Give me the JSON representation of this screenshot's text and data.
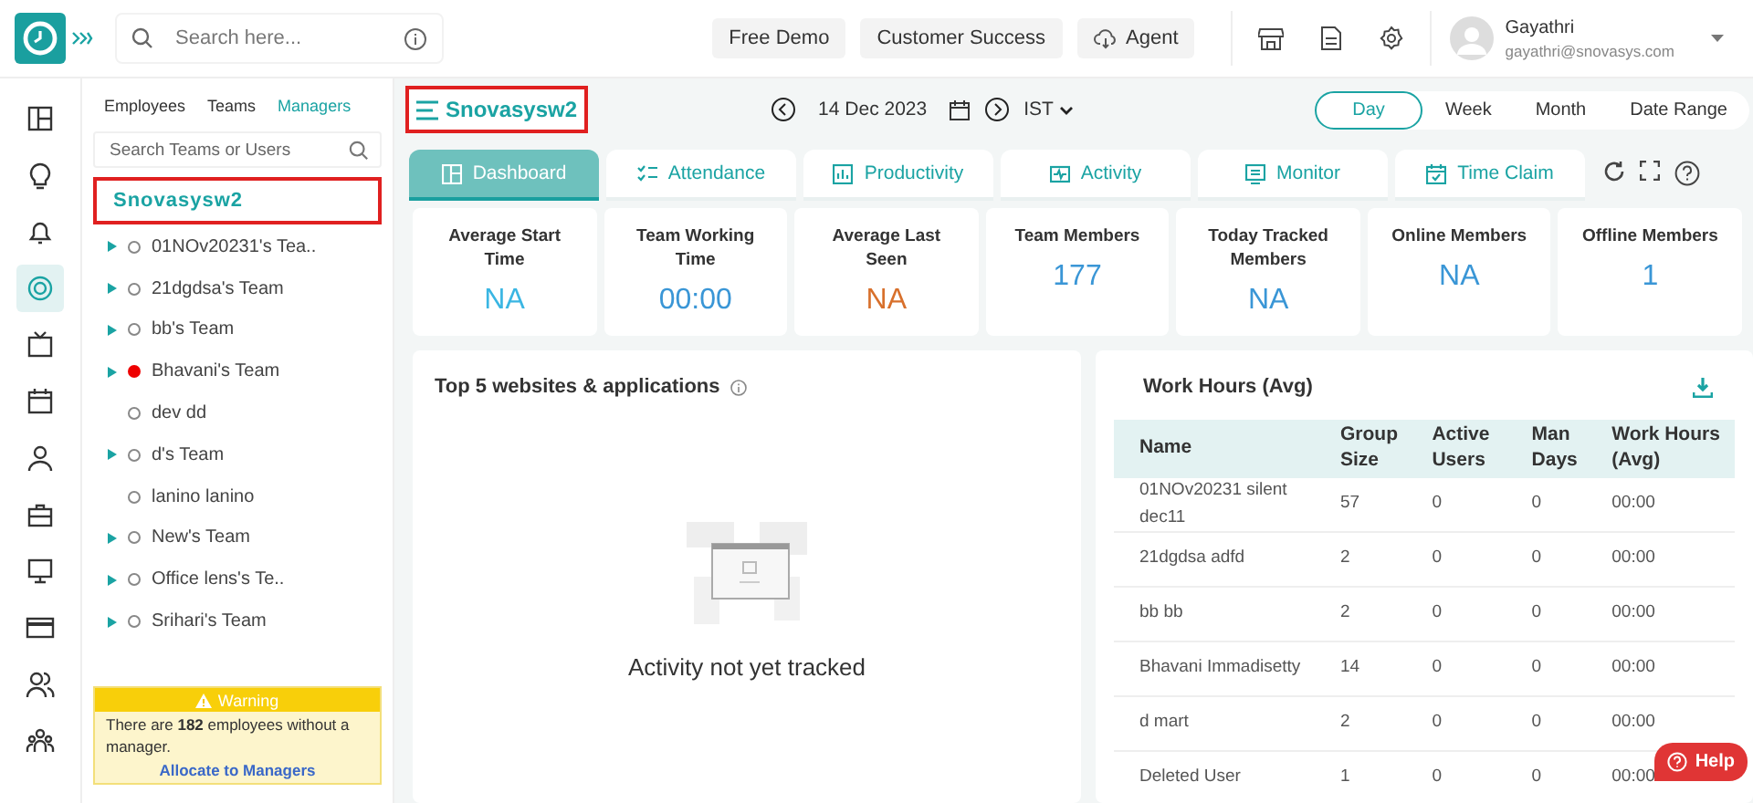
{
  "topbar": {
    "search": {
      "placeholder": "Search here..."
    },
    "buttons": [
      {
        "label": "Free Demo",
        "kind": "plain"
      },
      {
        "label": "Customer Success",
        "kind": "plain"
      },
      {
        "label": "Agent",
        "kind": "cloud"
      }
    ],
    "user": {
      "name": "Gayathri",
      "email": "gayathri@snovasys.com"
    }
  },
  "rail": [
    {
      "kind": "layout",
      "selected": false
    },
    {
      "kind": "bulb",
      "selected": false
    },
    {
      "kind": "bell",
      "selected": false
    },
    {
      "kind": "target",
      "selected": true
    },
    {
      "kind": "tv",
      "selected": false
    },
    {
      "kind": "calendar",
      "selected": false
    },
    {
      "kind": "user",
      "selected": false
    },
    {
      "kind": "briefcase",
      "selected": false
    },
    {
      "kind": "monitor",
      "selected": false
    },
    {
      "kind": "card",
      "selected": false
    },
    {
      "kind": "users",
      "selected": false
    },
    {
      "kind": "team",
      "selected": false
    }
  ],
  "panel": {
    "tabs": [
      {
        "label": "Employees",
        "selected": false
      },
      {
        "label": "Teams",
        "selected": false
      },
      {
        "label": "Managers",
        "selected": true
      }
    ],
    "search": {
      "placeholder": "Search Teams or Users"
    },
    "root": "Snovasysw2",
    "items": [
      {
        "label": "01NOv20231's Tea..",
        "expandable": true,
        "alert": false
      },
      {
        "label": "21dgdsa's Team",
        "expandable": true,
        "alert": false
      },
      {
        "label": "bb's Team",
        "expandable": true,
        "alert": false
      },
      {
        "label": "Bhavani's Team",
        "expandable": true,
        "alert": true
      },
      {
        "label": "dev dd",
        "expandable": false,
        "alert": false
      },
      {
        "label": "d's Team",
        "expandable": true,
        "alert": false
      },
      {
        "label": "lanino lanino",
        "expandable": false,
        "alert": false
      },
      {
        "label": "New's Team",
        "expandable": true,
        "alert": false
      },
      {
        "label": "Office lens's Te..",
        "expandable": true,
        "alert": false
      },
      {
        "label": "Srihari's Team",
        "expandable": true,
        "alert": false
      }
    ],
    "warning": {
      "title": "Warning",
      "text": "There are **182** employees without a manager.",
      "link": "Allocate to Managers"
    }
  },
  "header": {
    "title": "Snovasysw2",
    "date": "14 Dec 2023",
    "timezone": "IST",
    "periods": [
      {
        "label": "Day",
        "selected": true
      },
      {
        "label": "Week",
        "selected": false
      },
      {
        "label": "Month",
        "selected": false
      },
      {
        "label": "Date Range",
        "selected": false
      }
    ]
  },
  "tabs": [
    {
      "label": "Dashboard",
      "kind": "dashboard",
      "selected": true
    },
    {
      "label": "Attendance",
      "kind": "attendance",
      "selected": false
    },
    {
      "label": "Productivity",
      "kind": "productivity",
      "selected": false
    },
    {
      "label": "Activity",
      "kind": "activity",
      "selected": false
    },
    {
      "label": "Monitor",
      "kind": "monitor",
      "selected": false
    },
    {
      "label": "Time Claim",
      "kind": "timeclaim",
      "selected": false
    }
  ],
  "stats": [
    {
      "label": "Average Start Time",
      "value": "NA",
      "color": "#3ab6e3"
    },
    {
      "label": "Team Working Time",
      "value": "00:00",
      "color": "#3a96d6"
    },
    {
      "label": "Average Last Seen",
      "value": "NA",
      "color": "#d8702c"
    },
    {
      "label": "Team Members",
      "value": "177",
      "color": "#3a96d6"
    },
    {
      "label": "Today Tracked Members",
      "value": "NA",
      "color": "#3a96d6"
    },
    {
      "label": "Online Members",
      "value": "NA",
      "color": "#3a96d6"
    },
    {
      "label": "Offline Members",
      "value": "1",
      "color": "#3a96d6"
    }
  ],
  "top_apps": {
    "title": "Top 5 websites & applications",
    "empty": "Activity not yet tracked"
  },
  "work_hours": {
    "title": "Work Hours (Avg)",
    "columns": [
      "Name",
      "Group Size",
      "Active Users",
      "Man Days",
      "Work Hours (Avg)"
    ],
    "rows": [
      [
        "01NOv20231 silent dec11",
        "57",
        "0",
        "0",
        "00:00"
      ],
      [
        "21dgdsa adfd",
        "2",
        "0",
        "0",
        "00:00"
      ],
      [
        "bb bb",
        "2",
        "0",
        "0",
        "00:00"
      ],
      [
        "Bhavani Immadisetty",
        "14",
        "0",
        "0",
        "00:00"
      ],
      [
        "d mart",
        "2",
        "0",
        "0",
        "00:00"
      ],
      [
        "Deleted User",
        "1",
        "0",
        "0",
        "00:00"
      ]
    ]
  },
  "help": {
    "label": "Help"
  }
}
